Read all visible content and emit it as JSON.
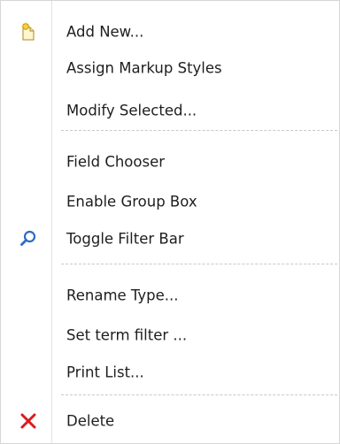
{
  "menu": {
    "items": [
      {
        "label": "Add New...",
        "icon": "add-new-icon"
      },
      {
        "label": "Assign Markup Styles",
        "icon": ""
      },
      {
        "label": "Modify Selected...",
        "icon": ""
      },
      {
        "label": "Field Chooser",
        "icon": ""
      },
      {
        "label": "Enable Group Box",
        "icon": ""
      },
      {
        "label": "Toggle Filter Bar",
        "icon": "search-icon"
      },
      {
        "label": "Rename Type...",
        "icon": ""
      },
      {
        "label": "Set term filter ...",
        "icon": ""
      },
      {
        "label": "Print List...",
        "icon": ""
      },
      {
        "label": "Delete",
        "icon": "delete-icon"
      }
    ]
  },
  "colors": {
    "text": "#1e1e1e",
    "separator": "#c8c8c8",
    "delete_icon": "#d91c1c",
    "search_icon": "#2b6cc4"
  }
}
